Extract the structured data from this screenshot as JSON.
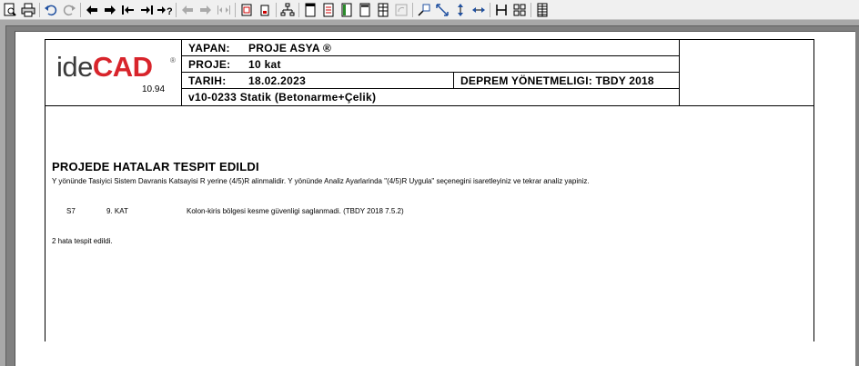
{
  "toolbar": {
    "icons": [
      "print-preview-icon",
      "print-icon",
      "undo-icon",
      "redo-icon",
      "arrow-left-icon",
      "arrow-right-icon",
      "arrow-left-bar-icon",
      "arrow-right-bar-icon",
      "arrow-right-question-icon",
      "arrow-left-disabled-icon",
      "arrow-right-disabled-icon",
      "arrows-split-icon",
      "page-red-icon",
      "page-small-icon",
      "tree-icon",
      "page-layout-icon",
      "page-red-lines-icon",
      "page-green-icon",
      "page-top-icon",
      "table-icon",
      "rotate-icon",
      "zoom-icon",
      "resize-icon",
      "vertical-arrows-icon",
      "horizontal-arrows-icon",
      "split-h-icon",
      "grid-icon",
      "columns-icon"
    ]
  },
  "header": {
    "logo_ide": "ide",
    "logo_cad": "CAD",
    "logo_reg": "®",
    "version": "10.94",
    "rows": [
      {
        "key": "YAPAN:",
        "value": "PROJE ASYA ®"
      },
      {
        "key": "PROJE:",
        "value": "10 kat"
      },
      {
        "key": "TARIH:",
        "value": "18.02.2023"
      }
    ],
    "program": "v10-0233 Statik (Betonarme+Çelik)",
    "deprem": "DEPREM YÖNETMELIGI: TBDY 2018"
  },
  "report": {
    "title": "PROJEDE HATALAR TESPIT EDILDI",
    "description": "Y yönünde Tasiyici Sistem Davranis Katsayisi R yerine (4/5)R alinmalidir.  Y yönünde Analiz Ayarlarinda \"(4/5)R Uygula\"  seçenegini isaretleyiniz ve tekrar analiz yapiniz.",
    "errors": [
      {
        "element": "S7",
        "floor": "9. KAT",
        "message": "Kolon-kiris bölgesi kesme güvenligi saglanmadi. (TBDY 2018 7.5.2)"
      }
    ],
    "summary": "2 hata tespit edildi."
  },
  "colors": {
    "logo_red": "#d8242b",
    "logo_gray": "#3b3b3b"
  }
}
